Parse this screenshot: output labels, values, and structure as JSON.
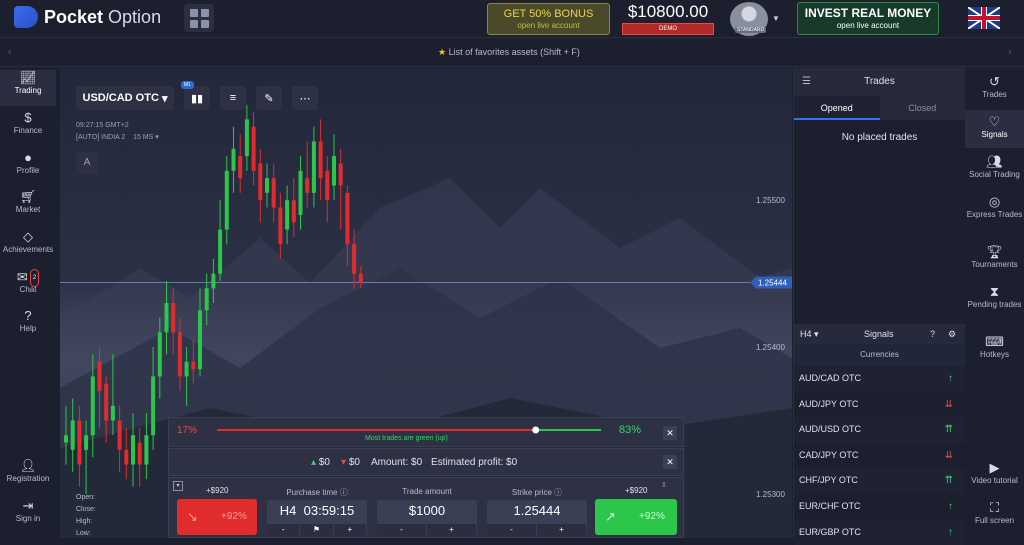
{
  "header": {
    "brand_bold": "Pocket",
    "brand_thin": "Option",
    "bonus_title": "GET 50% BONUS",
    "bonus_sub": "open live account",
    "balance": "$10800.00",
    "balance_mode": "DEMO",
    "user_status": "STANDARD",
    "invest_title": "INVEST REAL MONEY",
    "invest_sub": "open live account",
    "language": "English (UK)"
  },
  "favorites": {
    "text": "List of favorites assets (Shift + F)"
  },
  "left_nav": [
    {
      "label": "Trading",
      "icon": "chart-line-icon"
    },
    {
      "label": "Finance",
      "icon": "dollar-icon"
    },
    {
      "label": "Profile",
      "icon": "user-icon"
    },
    {
      "label": "Market",
      "icon": "cart-icon"
    },
    {
      "label": "Achievements",
      "icon": "diamond-icon"
    },
    {
      "label": "Chat",
      "icon": "chat-icon",
      "badge": "2"
    },
    {
      "label": "Help",
      "icon": "help-icon"
    },
    {
      "label": "Registration",
      "icon": "user-plus-icon"
    },
    {
      "label": "Sign in",
      "icon": "sign-in-icon"
    }
  ],
  "chart": {
    "asset": "USD/CAD OTC",
    "timeframe_badge": "M1",
    "time": "09:27:15 GMT+2",
    "server": "[AUTO] INDIA 2",
    "ping": "15 MS",
    "label_a": "A",
    "ohlc_labels": [
      "Open:",
      "Close:",
      "High:",
      "Low:"
    ],
    "price_ticks": [
      "1.25500",
      "1.25400",
      "1.25300"
    ],
    "current_price": "1.25444"
  },
  "chart_data": {
    "type": "candlestick",
    "candles": [
      {
        "o": 1.25335,
        "c": 1.2534,
        "h": 1.2536,
        "l": 1.2532
      },
      {
        "o": 1.2533,
        "c": 1.2535,
        "h": 1.25365,
        "l": 1.25315
      },
      {
        "o": 1.2535,
        "c": 1.2532,
        "h": 1.2536,
        "l": 1.25305
      },
      {
        "o": 1.2533,
        "c": 1.2534,
        "h": 1.2535,
        "l": 1.253
      },
      {
        "o": 1.2534,
        "c": 1.2538,
        "h": 1.25395,
        "l": 1.25325
      },
      {
        "o": 1.2539,
        "c": 1.2537,
        "h": 1.254,
        "l": 1.25345
      },
      {
        "o": 1.25375,
        "c": 1.2535,
        "h": 1.2538,
        "l": 1.25335
      },
      {
        "o": 1.2535,
        "c": 1.2536,
        "h": 1.25395,
        "l": 1.2534
      },
      {
        "o": 1.2535,
        "c": 1.2533,
        "h": 1.2536,
        "l": 1.25315
      },
      {
        "o": 1.2533,
        "c": 1.2532,
        "h": 1.25345,
        "l": 1.2531
      },
      {
        "o": 1.2532,
        "c": 1.2534,
        "h": 1.25355,
        "l": 1.25305
      },
      {
        "o": 1.25335,
        "c": 1.2532,
        "h": 1.25345,
        "l": 1.25305
      },
      {
        "o": 1.2532,
        "c": 1.2534,
        "h": 1.25355,
        "l": 1.2531
      },
      {
        "o": 1.2534,
        "c": 1.2538,
        "h": 1.254,
        "l": 1.2533
      },
      {
        "o": 1.2538,
        "c": 1.2541,
        "h": 1.2542,
        "l": 1.25365
      },
      {
        "o": 1.2541,
        "c": 1.2543,
        "h": 1.25445,
        "l": 1.25395
      },
      {
        "o": 1.2543,
        "c": 1.2541,
        "h": 1.2544,
        "l": 1.25395
      },
      {
        "o": 1.2541,
        "c": 1.2538,
        "h": 1.2542,
        "l": 1.2537
      },
      {
        "o": 1.2538,
        "c": 1.2539,
        "h": 1.254,
        "l": 1.2536
      },
      {
        "o": 1.2539,
        "c": 1.25385,
        "h": 1.25405,
        "l": 1.25375
      },
      {
        "o": 1.25385,
        "c": 1.25425,
        "h": 1.2544,
        "l": 1.2538
      },
      {
        "o": 1.25425,
        "c": 1.2544,
        "h": 1.2545,
        "l": 1.25415
      },
      {
        "o": 1.2544,
        "c": 1.2545,
        "h": 1.2546,
        "l": 1.2543
      },
      {
        "o": 1.2545,
        "c": 1.2548,
        "h": 1.255,
        "l": 1.25445
      },
      {
        "o": 1.2548,
        "c": 1.2552,
        "h": 1.2553,
        "l": 1.2547
      },
      {
        "o": 1.2552,
        "c": 1.25535,
        "h": 1.2555,
        "l": 1.25505
      },
      {
        "o": 1.2553,
        "c": 1.25515,
        "h": 1.25545,
        "l": 1.25505
      },
      {
        "o": 1.2553,
        "c": 1.25555,
        "h": 1.25565,
        "l": 1.2552
      },
      {
        "o": 1.2555,
        "c": 1.2552,
        "h": 1.2556,
        "l": 1.2551
      },
      {
        "o": 1.25525,
        "c": 1.255,
        "h": 1.25535,
        "l": 1.25485
      },
      {
        "o": 1.25505,
        "c": 1.25515,
        "h": 1.25525,
        "l": 1.25495
      },
      {
        "o": 1.25515,
        "c": 1.25495,
        "h": 1.25525,
        "l": 1.25485
      },
      {
        "o": 1.25495,
        "c": 1.2547,
        "h": 1.25505,
        "l": 1.2546
      },
      {
        "o": 1.2548,
        "c": 1.255,
        "h": 1.2551,
        "l": 1.2547
      },
      {
        "o": 1.255,
        "c": 1.25485,
        "h": 1.25515,
        "l": 1.25475
      },
      {
        "o": 1.2549,
        "c": 1.2552,
        "h": 1.2553,
        "l": 1.2548
      },
      {
        "o": 1.25515,
        "c": 1.25505,
        "h": 1.2554,
        "l": 1.25495
      },
      {
        "o": 1.25505,
        "c": 1.2554,
        "h": 1.2555,
        "l": 1.25495
      },
      {
        "o": 1.2554,
        "c": 1.25515,
        "h": 1.25555,
        "l": 1.255
      },
      {
        "o": 1.2552,
        "c": 1.255,
        "h": 1.2553,
        "l": 1.25485
      },
      {
        "o": 1.2551,
        "c": 1.2553,
        "h": 1.25545,
        "l": 1.255
      },
      {
        "o": 1.25525,
        "c": 1.2551,
        "h": 1.25535,
        "l": 1.2548
      },
      {
        "o": 1.25505,
        "c": 1.2547,
        "h": 1.2551,
        "l": 1.25455
      },
      {
        "o": 1.2547,
        "c": 1.2545,
        "h": 1.2548,
        "l": 1.2544
      },
      {
        "o": 1.2545,
        "c": 1.25444,
        "h": 1.25455,
        "l": 1.2544
      }
    ],
    "ylim": [
      1.2527,
      1.2559
    ],
    "current_price": 1.25444
  },
  "trend": {
    "sell_pct": "17%",
    "buy_pct": "83%",
    "buy_fraction": 0.83,
    "note": "Most trades are green (up)"
  },
  "amounts": {
    "up_amount": "$0",
    "down_amount": "$0",
    "amount": "Amount: $0",
    "profit": "Estimated profit: $0"
  },
  "trade": {
    "sell_payout": "+$920",
    "buy_payout": "+$920",
    "sell_pct": "+92%",
    "buy_pct": "+92%",
    "purchase_label": "Purchase time",
    "timeframe": "H4",
    "purchase_time": "03:59:15",
    "amount_label": "Trade amount",
    "amount_value": "$1000",
    "strike_label": "Strike price",
    "strike_value": "1.25444",
    "minus": "-",
    "plus": "+"
  },
  "trades_panel": {
    "title": "Trades",
    "tab_opened": "Opened",
    "tab_closed": "Closed",
    "empty": "No placed trades"
  },
  "signals": {
    "timeframe": "H4",
    "title": "Signals",
    "subtitle": "Currencies",
    "rows": [
      {
        "pair": "AUD/CAD OTC",
        "arrow": "↑",
        "dir": "up"
      },
      {
        "pair": "AUD/JPY OTC",
        "arrow": "⇊",
        "dir": "down"
      },
      {
        "pair": "AUD/USD OTC",
        "arrow": "⇈",
        "dir": "up"
      },
      {
        "pair": "CAD/JPY OTC",
        "arrow": "⇊",
        "dir": "down"
      },
      {
        "pair": "CHF/JPY OTC",
        "arrow": "⇈",
        "dir": "up"
      },
      {
        "pair": "EUR/CHF OTC",
        "arrow": "↑",
        "dir": "up"
      },
      {
        "pair": "EUR/GBP OTC",
        "arrow": "↑",
        "dir": "up"
      }
    ]
  },
  "right_nav": [
    {
      "label": "Trades",
      "icon": "history-icon"
    },
    {
      "label": "Signals",
      "icon": "heart-pulse-icon"
    },
    {
      "label": "Social Trading",
      "icon": "users-icon"
    },
    {
      "label": "Express Trades",
      "icon": "target-icon"
    },
    {
      "label": "Tournaments",
      "icon": "trophy-icon"
    },
    {
      "label": "Pending trades",
      "icon": "hourglass-icon"
    },
    {
      "label": "Hotkeys",
      "icon": "keyboard-icon"
    },
    {
      "label": "Video tutorial",
      "icon": "video-icon"
    },
    {
      "label": "Full screen",
      "icon": "fullscreen-icon"
    }
  ],
  "colors": {
    "up": "#2cc64a",
    "down": "#e02c2c",
    "accent": "#3a6df0"
  }
}
